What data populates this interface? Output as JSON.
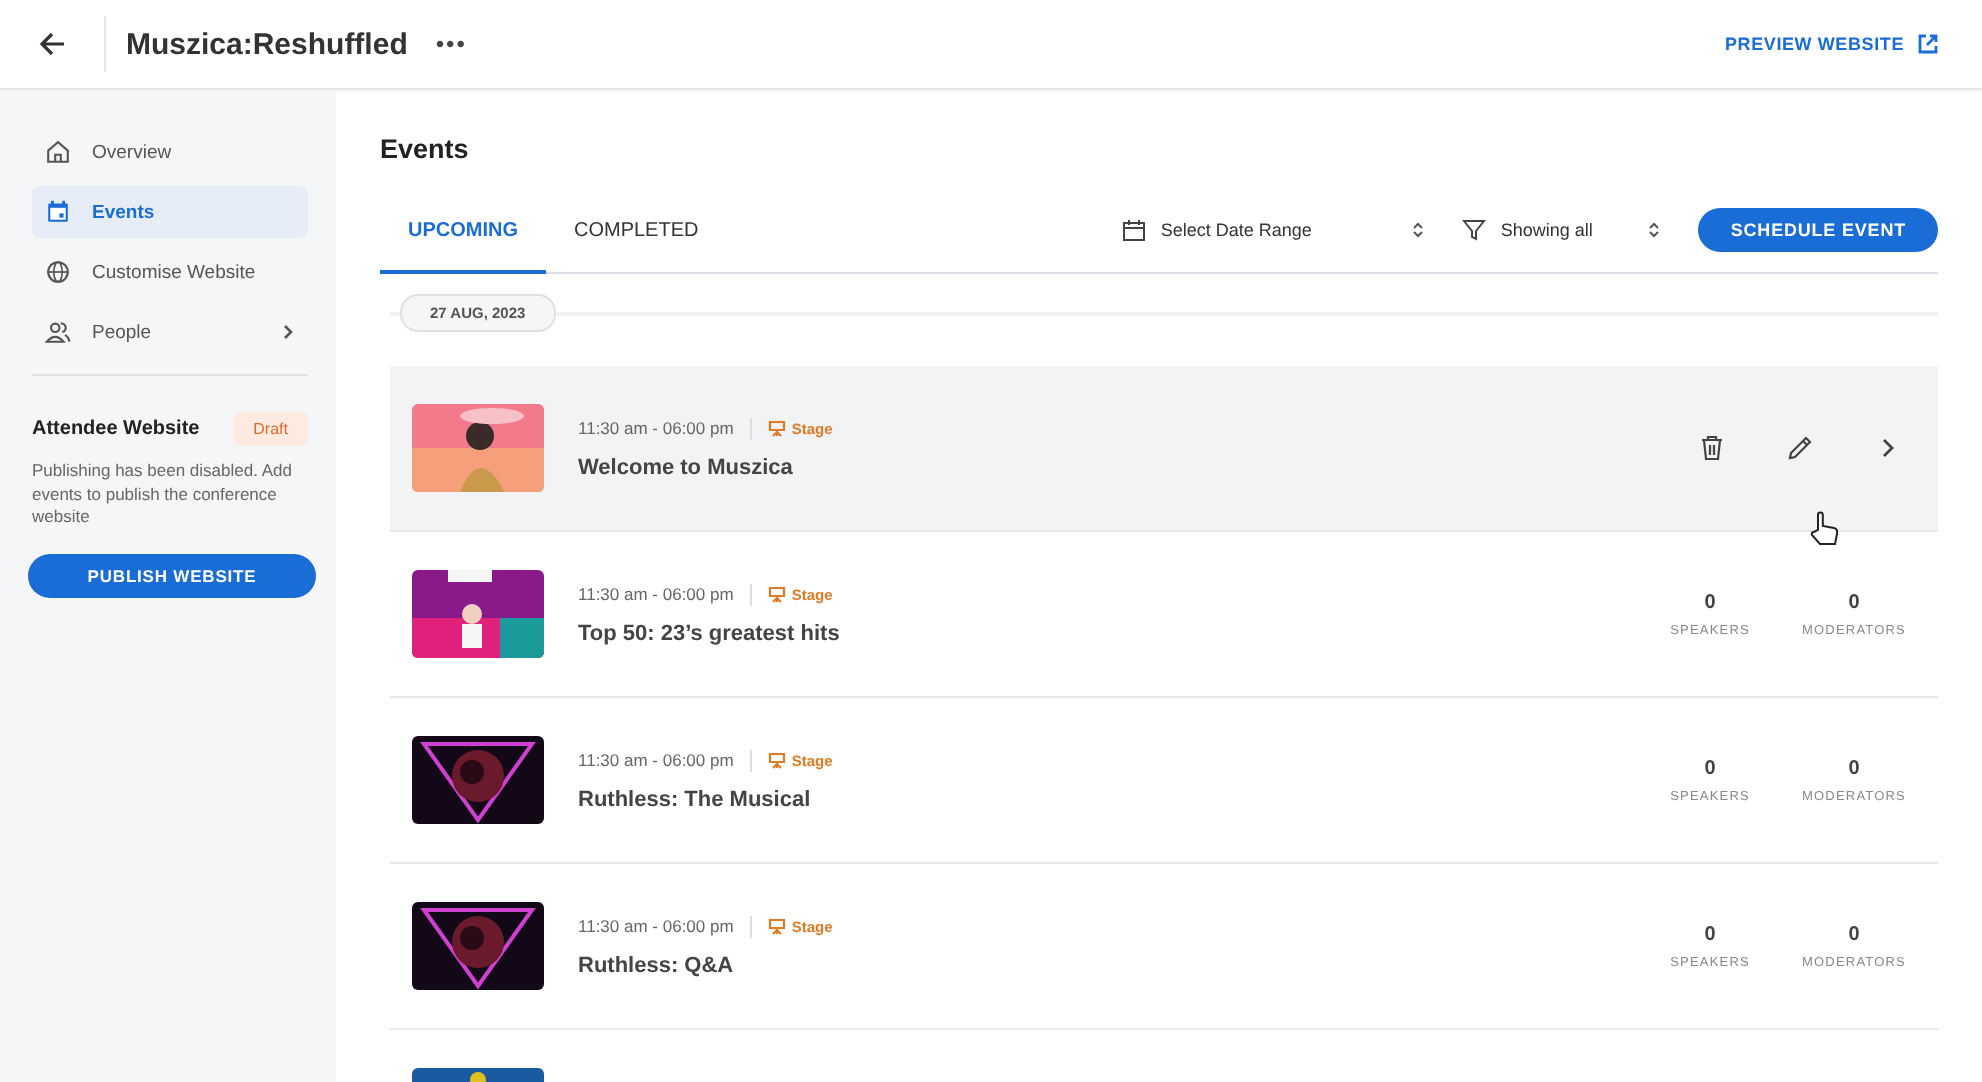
{
  "header": {
    "title": "Muszica:Reshuffled",
    "menu": "•••",
    "preview_link": "PREVIEW WEBSITE"
  },
  "sidebar": {
    "items": [
      {
        "label": "Overview",
        "selected": false,
        "expandable": false
      },
      {
        "label": "Events",
        "selected": true,
        "expandable": false
      },
      {
        "label": "Customise Website",
        "selected": false,
        "expandable": false
      },
      {
        "label": "People",
        "selected": false,
        "expandable": true
      }
    ],
    "website": {
      "title": "Attendee Website",
      "badge": "Draft",
      "note": "Publishing has been disabled. Add events to publish the conference website",
      "button": "PUBLISH WEBSITE"
    }
  },
  "main": {
    "title": "Events",
    "tabs": [
      {
        "label": "UPCOMING",
        "selected": true
      },
      {
        "label": "COMPLETED",
        "selected": false
      }
    ],
    "date_filter": "Select Date Range",
    "status_filter": "Showing all",
    "schedule_button": "SCHEDULE EVENT",
    "date_chip": "27 AUG, 2023",
    "events": [
      {
        "time": "11:30 am - 06:00 pm",
        "venue": "Stage",
        "title": "Welcome to Muszica",
        "hovered": true
      },
      {
        "time": "11:30 am - 06:00 pm",
        "venue": "Stage",
        "title": "Top 50: 23’s greatest hits",
        "hovered": false,
        "speakers": "0",
        "speakers_label": "SPEAKERS",
        "moderators": "0",
        "moderators_label": "MODERATORS"
      },
      {
        "time": "11:30 am - 06:00 pm",
        "venue": "Stage",
        "title": "Ruthless: The Musical",
        "hovered": false,
        "speakers": "0",
        "speakers_label": "SPEAKERS",
        "moderators": "0",
        "moderators_label": "MODERATORS"
      },
      {
        "time": "11:30 am - 06:00 pm",
        "venue": "Stage",
        "title": "Ruthless: Q&A",
        "hovered": false,
        "speakers": "0",
        "speakers_label": "SPEAKERS",
        "moderators": "0",
        "moderators_label": "MODERATORS"
      }
    ]
  }
}
